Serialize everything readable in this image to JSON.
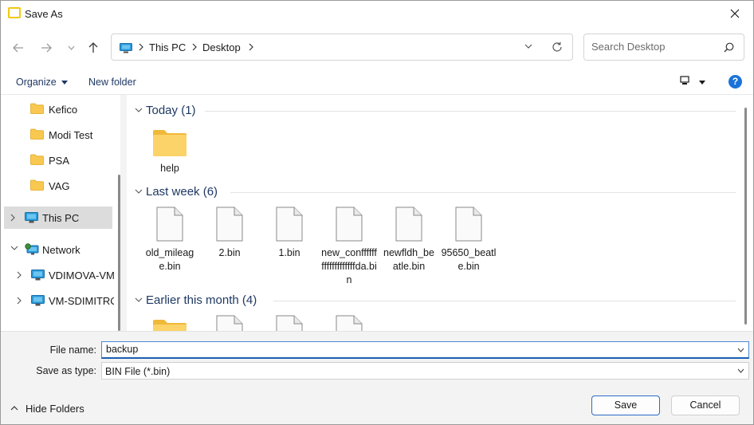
{
  "window": {
    "title": "Save As"
  },
  "address": {
    "crumbs": [
      "This PC",
      "Desktop"
    ]
  },
  "search": {
    "placeholder": "Search Desktop"
  },
  "commands": {
    "organize": "Organize",
    "new_folder": "New folder",
    "help": "?"
  },
  "sidebar": {
    "items": [
      {
        "label": "Kefico",
        "icon": "folder-icon"
      },
      {
        "label": "Modi Test",
        "icon": "folder-icon"
      },
      {
        "label": "PSA",
        "icon": "folder-icon"
      },
      {
        "label": "VAG",
        "icon": "folder-icon"
      },
      {
        "label": "This PC",
        "icon": "computer-icon"
      },
      {
        "label": "Network",
        "icon": "network-icon"
      },
      {
        "label": "VDIMOVA-VM",
        "icon": "computer-icon"
      },
      {
        "label": "VM-SDIMITRC",
        "icon": "computer-icon"
      }
    ]
  },
  "groups": [
    {
      "label": "Today (1)",
      "files": [
        {
          "name": "help",
          "type": "folder"
        }
      ]
    },
    {
      "label": "Last week (6)",
      "files": [
        {
          "name": "old_mileage.bin",
          "type": "file"
        },
        {
          "name": "2.bin",
          "type": "file"
        },
        {
          "name": "1.bin",
          "type": "file"
        },
        {
          "name": "new_confffffffffffffffffffda.bin",
          "type": "file"
        },
        {
          "name": "newfldh_beatle.bin",
          "type": "file"
        },
        {
          "name": "95650_beatle.bin",
          "type": "file"
        }
      ]
    },
    {
      "label": "Earlier this month (4)",
      "files": []
    }
  ],
  "form": {
    "file_name_label": "File name:",
    "file_name_value": "backup",
    "save_type_label": "Save as type:",
    "save_type_value": "BIN File (*.bin)"
  },
  "footer": {
    "hide_folders": "Hide Folders",
    "save": "Save",
    "cancel": "Cancel"
  },
  "colors": {
    "accent": "#1a5fb4",
    "folder": "#f8c850",
    "selection": "#dcdcdc"
  }
}
